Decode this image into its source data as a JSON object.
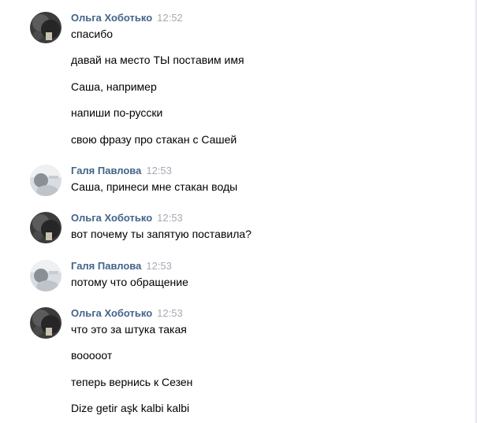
{
  "messages": [
    {
      "author": "Ольга Хоботько",
      "avatar_icon": "dark-photo-avatar-icon",
      "time": "12:52",
      "lines": [
        "спасибо",
        "давай на место ТЫ поставим имя",
        "Саша, например",
        "напиши по-русски",
        "свою фразу про стакан с Сашей"
      ]
    },
    {
      "author": "Галя Павлова",
      "avatar_icon": "light-photo-avatar-icon",
      "time": "12:53",
      "lines": [
        "Саша, принеси мне стакан воды"
      ]
    },
    {
      "author": "Ольга Хоботько",
      "avatar_icon": "dark-photo-avatar-icon",
      "time": "12:53",
      "lines": [
        "вот почему ты запятую поставила?"
      ]
    },
    {
      "author": "Галя Павлова",
      "avatar_icon": "light-photo-avatar-icon",
      "time": "12:53",
      "lines": [
        "потому что обращение"
      ]
    },
    {
      "author": "Ольга Хоботько",
      "avatar_icon": "dark-photo-avatar-icon",
      "time": "12:53",
      "lines": [
        "что это за штука такая",
        "вооооот",
        "теперь вернись к Сезен",
        "Dize getir aşk kalbi kalbi"
      ]
    }
  ],
  "colors": {
    "author": "#42648b",
    "time": "#a5aab3",
    "text": "#000000",
    "background": "#ffffff"
  }
}
